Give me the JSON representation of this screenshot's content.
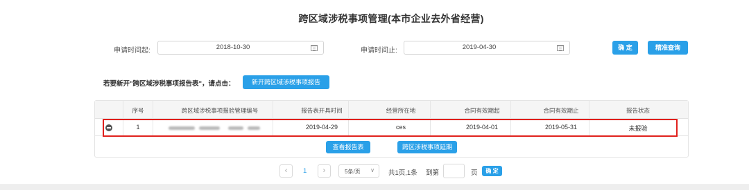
{
  "title": "跨区域涉税事项管理(本市企业去外省经营)",
  "filters": {
    "start_label": "申请时间起:",
    "start_value": "2018-10-30",
    "end_label": "申请时间止:",
    "end_value": "2019-04-30",
    "confirm_label": "确 定",
    "precise_label": "精准查询"
  },
  "notice": {
    "text": "若要新开\"跨区域涉税事项报告表\"，请点击：",
    "button_label": "新开跨区域涉税事项报告"
  },
  "table": {
    "headers": [
      "序号",
      "跨区域涉税事项报验管理编号",
      "报告表开具时间",
      "经营所在地",
      "合同有效期起",
      "合同有效期止",
      "报告状态"
    ],
    "rows": [
      {
        "index": "1",
        "code_redacted": true,
        "issue_date": "2019-04-29",
        "location": "ces",
        "contract_start": "2019-04-01",
        "contract_end": "2019-05-31",
        "status": "未报验"
      }
    ],
    "actions": {
      "view_label": "查看报告表",
      "extend_label": "跨区涉税事项延期"
    }
  },
  "pagination": {
    "prev": "‹",
    "current_page": "1",
    "next": "›",
    "page_size": "5条/页",
    "summary": "共1页,1条",
    "goto_label": "到第",
    "page_unit": "页",
    "goto_button": "确 定"
  },
  "colors": {
    "accent": "#2aa0e8",
    "highlight": "#e0201c"
  }
}
